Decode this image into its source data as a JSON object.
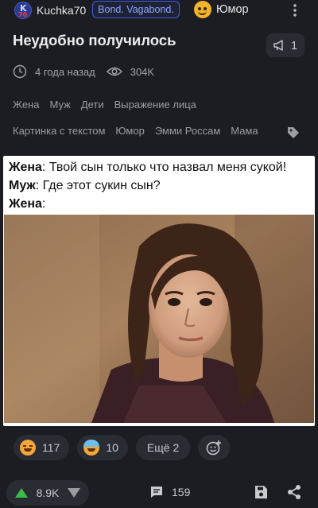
{
  "header": {
    "avatar_text_top": "K",
    "avatar_text_bottom": "70",
    "username": "Kuchka70",
    "badge": "Bond. Vagabond.",
    "community": "Юмор",
    "community_icon": "smiley-face-icon",
    "more_icon": "more-vertical-icon"
  },
  "post": {
    "title": "Неудобно получилось",
    "rating_count": "1",
    "time": "4 года назад",
    "views": "304K",
    "tags_row1": [
      "Жена",
      "Муж",
      "Дети",
      "Выражение лица"
    ],
    "tags_row2": [
      "Картинка с текстом",
      "Юмор",
      "Эмми Россам",
      "Мама"
    ],
    "content": {
      "line1_speaker": "Жена",
      "line1_text": ": Твой сын только что назвал меня сукой!",
      "line2_speaker": "Муж",
      "line2_text": ": Где этот сукин сын?",
      "line3_speaker": "Жена",
      "line3_text": ":"
    }
  },
  "reactions": {
    "laugh_count": "117",
    "cool_count": "10",
    "more_label": "Ещё 2"
  },
  "footer": {
    "score": "8.9K",
    "comments": "159"
  },
  "colors": {
    "background": "#1c1d22",
    "accent_green": "#3dbb4a",
    "badge_border": "#3f5fd6"
  }
}
